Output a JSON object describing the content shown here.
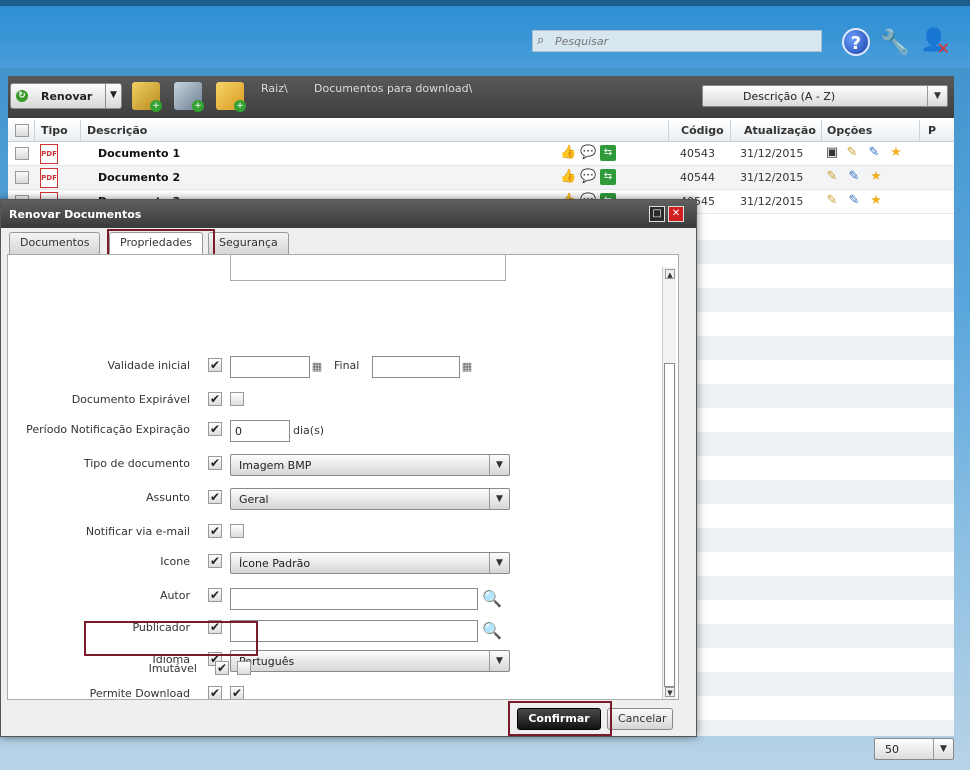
{
  "header": {
    "search_placeholder": "Pesquisar",
    "help_label": "?"
  },
  "toolbar": {
    "renew_label": "Renovar",
    "breadcrumb_root": "Raiz\\",
    "breadcrumb_folder": "Documentos para download\\",
    "sort_value": "Descrição (A - Z)"
  },
  "table": {
    "headers": {
      "tipo": "Tipo",
      "descricao": "Descrição",
      "codigo": "Código",
      "atualizacao": "Atualização",
      "opcoes": "Opções",
      "p": "P"
    },
    "rows": [
      {
        "name": "Documento 1",
        "code": "40543",
        "date": "31/12/2015"
      },
      {
        "name": "Documento 2",
        "code": "40544",
        "date": "31/12/2015"
      },
      {
        "name": "Documento 3",
        "code": "40545",
        "date": "31/12/2015"
      }
    ],
    "pdf_label": "PDF"
  },
  "pagination": {
    "page_size": "50"
  },
  "dialog": {
    "title": "Renovar Documentos",
    "tabs": [
      "Documentos",
      "Propriedades",
      "Segurança"
    ],
    "active_tab": "Propriedades",
    "fields": {
      "validade_inicial": "Validade inicial",
      "final": "Final",
      "documento_expiravel": "Documento Expirável",
      "periodo_notificacao": "Período Notificação Expiração",
      "periodo_value": "0",
      "dias_suffix": "dia(s)",
      "tipo_documento": "Tipo de documento",
      "tipo_documento_value": "Imagem BMP",
      "assunto": "Assunto",
      "assunto_value": "Geral",
      "notificar_email": "Notificar via e-mail",
      "icone": "Icone",
      "icone_value": "Ícone Padrão",
      "autor": "Autor",
      "publicador": "Publicador",
      "idioma": "Idioma",
      "idioma_value": "Português",
      "permite_download": "Permite Download",
      "imutavel": "Imutável"
    },
    "buttons": {
      "confirm": "Confirmar",
      "cancel": "Cancelar"
    }
  },
  "icons": {
    "check_mark": "✔"
  },
  "colors": {
    "highlight_border": "#7a1a2a",
    "share_green": "#2e9a3a",
    "close_red": "#d02020"
  }
}
